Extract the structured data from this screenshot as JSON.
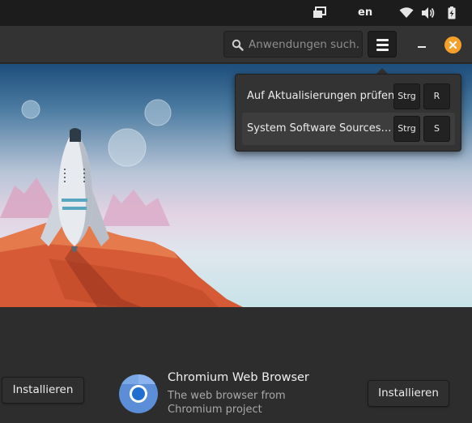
{
  "system_panel": {
    "language": "en",
    "icons": [
      "multitasking-icon",
      "wifi-icon",
      "volume-icon",
      "battery-icon"
    ]
  },
  "header": {
    "search_placeholder": "Anwendungen such…",
    "icons": [
      "search-icon",
      "menu-icon",
      "minimize-icon",
      "close-icon"
    ],
    "accent_color": "#f5a02a"
  },
  "menu": {
    "items": [
      {
        "label": "Auf Aktualisierungen prüfen",
        "keys": [
          "Strg",
          "R"
        ]
      },
      {
        "label": "System Software Sources…",
        "keys": [
          "Strg",
          "S"
        ]
      }
    ]
  },
  "featured_row": {
    "left_button": "Installieren",
    "app_name": "Chromium Web Browser",
    "app_description": "The web browser from Chromium project",
    "right_button": "Installieren",
    "app_icon": "chromium-icon"
  }
}
